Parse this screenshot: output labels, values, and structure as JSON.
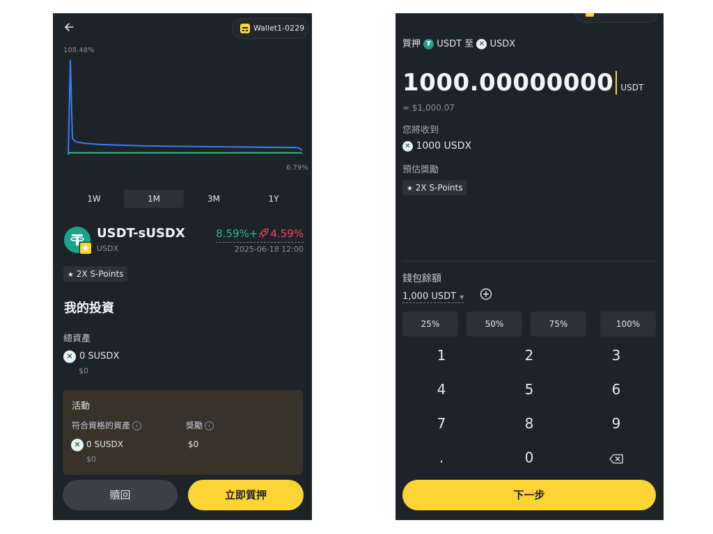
{
  "left": {
    "wallet": "Wallet1-0229",
    "chart": {
      "max_label": "108.48%",
      "min_label": "6.79%",
      "max_value": 108.48,
      "min_value": 6.79,
      "series": [
        {
          "color": "#3b7ef6",
          "points": [
            [
              0,
              1.6
            ],
            [
              3,
              108.48
            ],
            [
              6,
              20.5
            ],
            [
              9,
              17.5
            ],
            [
              15,
              15.8
            ],
            [
              25,
              14.8
            ],
            [
              45,
              13.6
            ],
            [
              75,
              12.7
            ],
            [
              110,
              12.0
            ],
            [
              160,
              11.4
            ],
            [
              220,
              10.9
            ],
            [
              280,
              10.4
            ],
            [
              330,
              10.0
            ],
            [
              333,
              8.5
            ],
            [
              336,
              6.79
            ]
          ]
        },
        {
          "color": "#2bbf7e",
          "points": [
            [
              0,
              4.2
            ],
            [
              333,
              4.2
            ],
            [
              336,
              3.4
            ]
          ]
        }
      ]
    },
    "timeframes": [
      "1W",
      "1M",
      "3M",
      "1Y"
    ],
    "active_timeframe": 1,
    "asset": {
      "name": "USDT-sUSDX",
      "sub": "USDX",
      "apy_green": "8.59%+",
      "apy_red": "4.59%",
      "date": "2025-06-18 12:00"
    },
    "points_badge": "2X S-Points",
    "section_title": "我的投資",
    "total_label": "總資產",
    "total_amount": "0 SUSDX",
    "total_usd": "$0",
    "activity": {
      "title": "活動",
      "eligible_label": "符合資格的資產",
      "reward_label": "獎勵",
      "eligible_amount": "0 SUSDX",
      "eligible_usd": "$0",
      "reward_amount": "$0"
    },
    "redeem_label": "贖回",
    "stake_label": "立即質押",
    "colors": {
      "accent": "#fcd535",
      "green": "#2ebd85",
      "red": "#f6465d",
      "bg": "#1e2229"
    }
  },
  "right": {
    "stake_prefix": "質押",
    "from_token": "USDT",
    "to_word": "至",
    "to_token": "USDX",
    "amount": "1000.00000000",
    "amount_unit": "USDT",
    "usd_estimate": "≈ $1,000.07",
    "receive_label": "您將收到",
    "receive_amount": "1000 USDX",
    "reward_label": "預估獎勵",
    "points_badge": "2X S-Points",
    "balance_label": "錢包餘額",
    "balance_value": "1,000 USDT",
    "percents": [
      "25%",
      "50%",
      "75%",
      "100%"
    ],
    "keys": [
      "1",
      "2",
      "3",
      "4",
      "5",
      "6",
      "7",
      "8",
      "9",
      ".",
      "0"
    ],
    "next_label": "下一步"
  }
}
